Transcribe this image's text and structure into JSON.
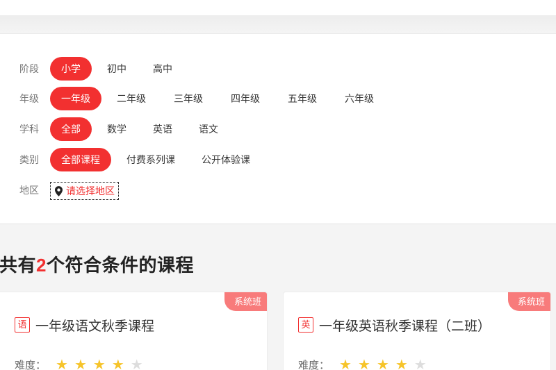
{
  "filters": {
    "stage": {
      "label": "阶段",
      "options": [
        "小学",
        "初中",
        "高中"
      ]
    },
    "grade": {
      "label": "年级",
      "options": [
        "一年级",
        "二年级",
        "三年级",
        "四年级",
        "五年级",
        "六年级"
      ]
    },
    "subject": {
      "label": "学科",
      "options": [
        "全部",
        "数学",
        "英语",
        "语文"
      ]
    },
    "category": {
      "label": "类别",
      "options": [
        "全部课程",
        "付费系列课",
        "公开体验课"
      ]
    },
    "region": {
      "label": "地区",
      "button": "请选择地区"
    }
  },
  "results": {
    "prefix": "共有",
    "count": "2",
    "suffix": "个符合条件的课程"
  },
  "courses": [
    {
      "tag": "系统班",
      "subject_icon": "语",
      "title": "一年级语文秋季课程",
      "difficulty_label": "难度：",
      "difficulty": 4,
      "difficulty_max": 5
    },
    {
      "tag": "系统班",
      "subject_icon": "英",
      "title": "一年级英语秋季课程（二班）",
      "difficulty_label": "难度：",
      "difficulty": 4,
      "difficulty_max": 5
    }
  ],
  "colors": {
    "accent": "#f23030",
    "badge": "#f87b7b",
    "star": "#f6c42a"
  }
}
